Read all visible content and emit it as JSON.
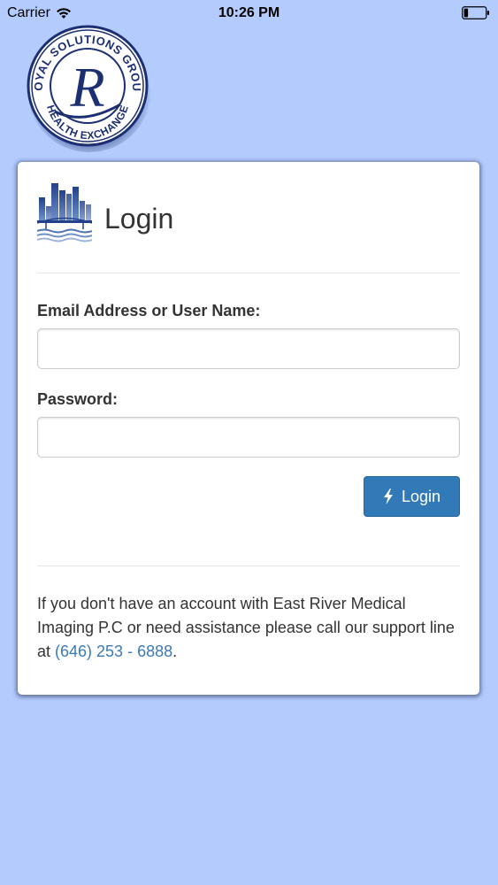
{
  "status_bar": {
    "carrier": "Carrier",
    "time": "10:26 PM",
    "icons": [
      "wifi-icon",
      "battery-icon"
    ]
  },
  "logo": {
    "ring_text_top": "ROYAL SOLUTIONS GROUP",
    "ring_text_bottom": "HEALTH EXCHANGE",
    "monogram": "R"
  },
  "login_card": {
    "header_icon": "skyline-bridge-icon",
    "title": "Login",
    "email_label": "Email Address or User Name:",
    "email_value": "",
    "password_label": "Password:",
    "password_value": "",
    "button_icon": "lightning-bolt-icon",
    "button_label": "Login",
    "help_text_prefix": "If you don't have an account with East River Medical Imaging P.C or need assistance please call our support line at ",
    "support_phone": "(646) 253 - 6888",
    "help_text_suffix": "."
  },
  "colors": {
    "background": "#b3cbfd",
    "card": "#ffffff",
    "primary_button": "#3279b7",
    "link": "#3a7ab7",
    "text": "#333333"
  }
}
